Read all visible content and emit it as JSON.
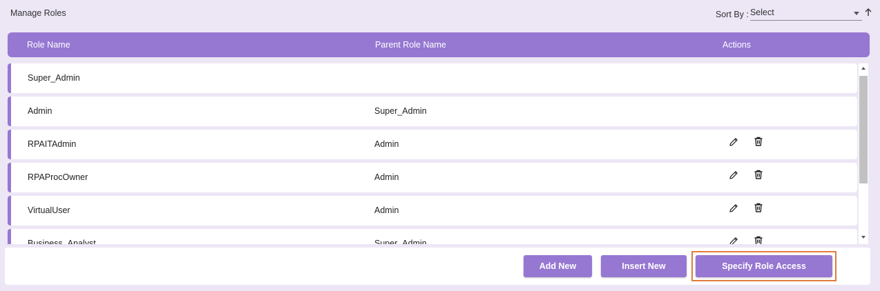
{
  "page": {
    "title": "Manage Roles"
  },
  "sort": {
    "label": "Sort By :",
    "value": "Select",
    "arrow_icon": "arrow-up-icon"
  },
  "table": {
    "headers": {
      "role_name": "Role Name",
      "parent_role_name": "Parent Role Name",
      "actions": "Actions"
    },
    "rows": [
      {
        "role": "Super_Admin",
        "parent": "",
        "actions": false
      },
      {
        "role": "Admin",
        "parent": "Super_Admin",
        "actions": false
      },
      {
        "role": "RPAITAdmin",
        "parent": "Admin",
        "actions": true
      },
      {
        "role": "RPAProcOwner",
        "parent": "Admin",
        "actions": true
      },
      {
        "role": "VirtualUser",
        "parent": "Admin",
        "actions": true
      },
      {
        "role": "Business_Analyst",
        "parent": "Super_Admin",
        "actions": true
      }
    ],
    "action_icons": [
      "pencil-icon",
      "trash-icon"
    ]
  },
  "footer": {
    "add_new": "Add New",
    "insert_new": "Insert New",
    "specify_role_access": "Specify Role Access"
  },
  "colors": {
    "accent": "#9677d2",
    "background": "#ece6f5",
    "focus": "#e07b3c"
  }
}
